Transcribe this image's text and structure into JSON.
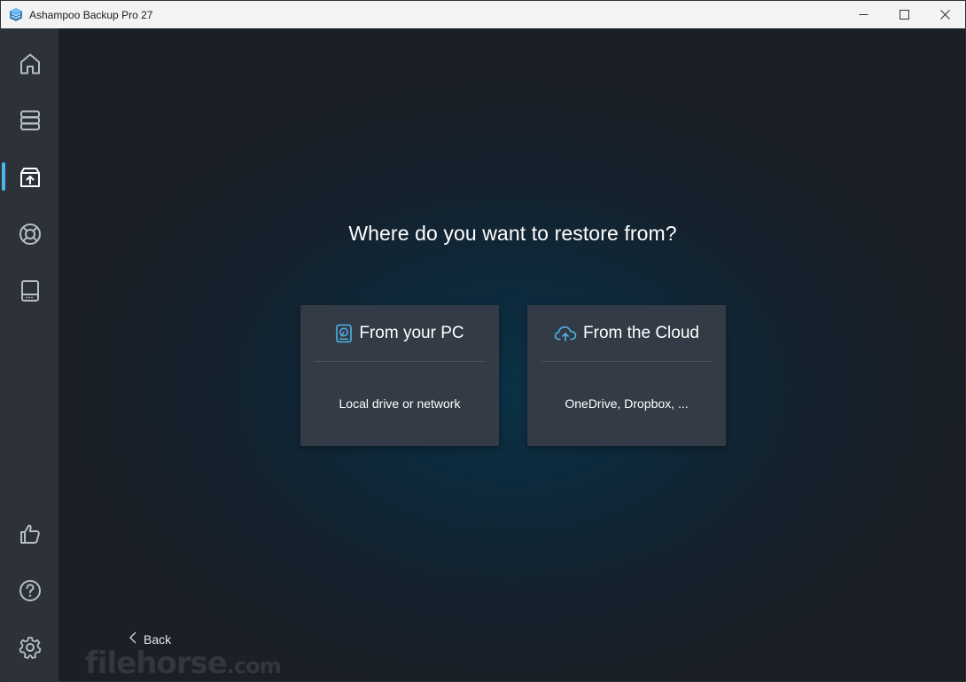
{
  "window": {
    "title": "Ashampoo Backup Pro 27"
  },
  "sidebar": {
    "top_items": [
      {
        "icon": "home-icon",
        "name": "Home"
      },
      {
        "icon": "backup-list-icon",
        "name": "Backup plans"
      },
      {
        "icon": "restore-icon",
        "name": "Restore",
        "active": true
      },
      {
        "icon": "rescue-icon",
        "name": "Rescue"
      },
      {
        "icon": "drive-icon",
        "name": "Drives"
      }
    ],
    "bottom_items": [
      {
        "icon": "thumbs-up-icon"
      },
      {
        "icon": "help-icon"
      },
      {
        "icon": "gear-icon"
      }
    ]
  },
  "main": {
    "question": "Where do you want to restore from?",
    "cards": [
      {
        "title": "From your PC",
        "subtitle": "Local drive or network",
        "icon": "hard-drive-icon"
      },
      {
        "title": "From the Cloud",
        "subtitle": "OneDrive, Dropbox, ...",
        "icon": "cloud-upload-icon"
      }
    ],
    "back_label": "Back"
  },
  "watermark": {
    "text": "filehorse",
    "suffix": ".com"
  },
  "colors": {
    "accent": "#4fb3e8",
    "sidebar_bg": "#2d323a",
    "card_bg": "#333b46",
    "titlebar_bg": "#f3f3f3"
  }
}
